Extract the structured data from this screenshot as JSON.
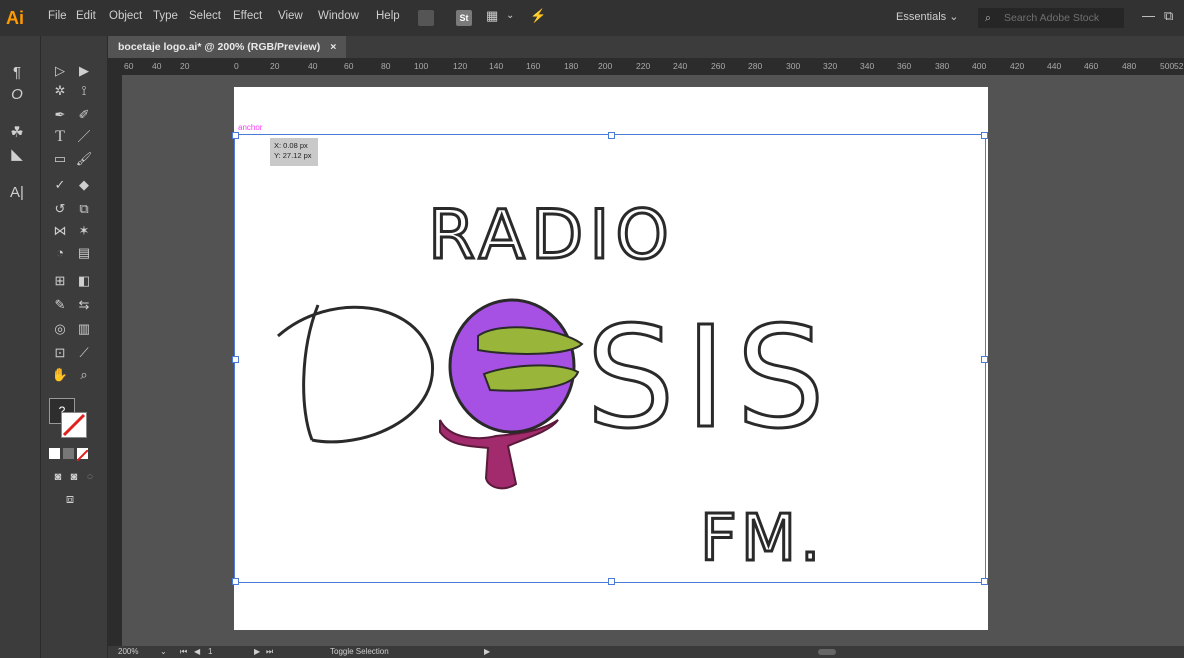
{
  "menubar": {
    "logo": "Ai",
    "items": [
      "File",
      "Edit",
      "Object",
      "Type",
      "Select",
      "Effect",
      "View",
      "Window",
      "Help"
    ],
    "workspace": "Essentials",
    "search_placeholder": "Search Adobe Stock"
  },
  "document_tab": {
    "title": "bocetaje logo.ai* @ 200% (RGB/Preview)"
  },
  "ruler": {
    "horizontal_ticks": [
      "60",
      "40",
      "20",
      "0",
      "20",
      "40",
      "60",
      "80",
      "100",
      "120",
      "140",
      "160",
      "180",
      "200",
      "220",
      "240",
      "260",
      "280",
      "300",
      "320",
      "340",
      "360",
      "380",
      "400",
      "420",
      "440",
      "460",
      "480",
      "500",
      "52"
    ]
  },
  "canvas": {
    "anchor_label": "anchor",
    "tooltip": {
      "x": "X: 0.08 px",
      "y": "Y: 27.12 px"
    }
  },
  "artwork": {
    "line1": "RADIO",
    "line2": "D SIS",
    "line3": "FM."
  },
  "statusbar": {
    "zoom": "200%",
    "status": "Toggle Selection"
  }
}
